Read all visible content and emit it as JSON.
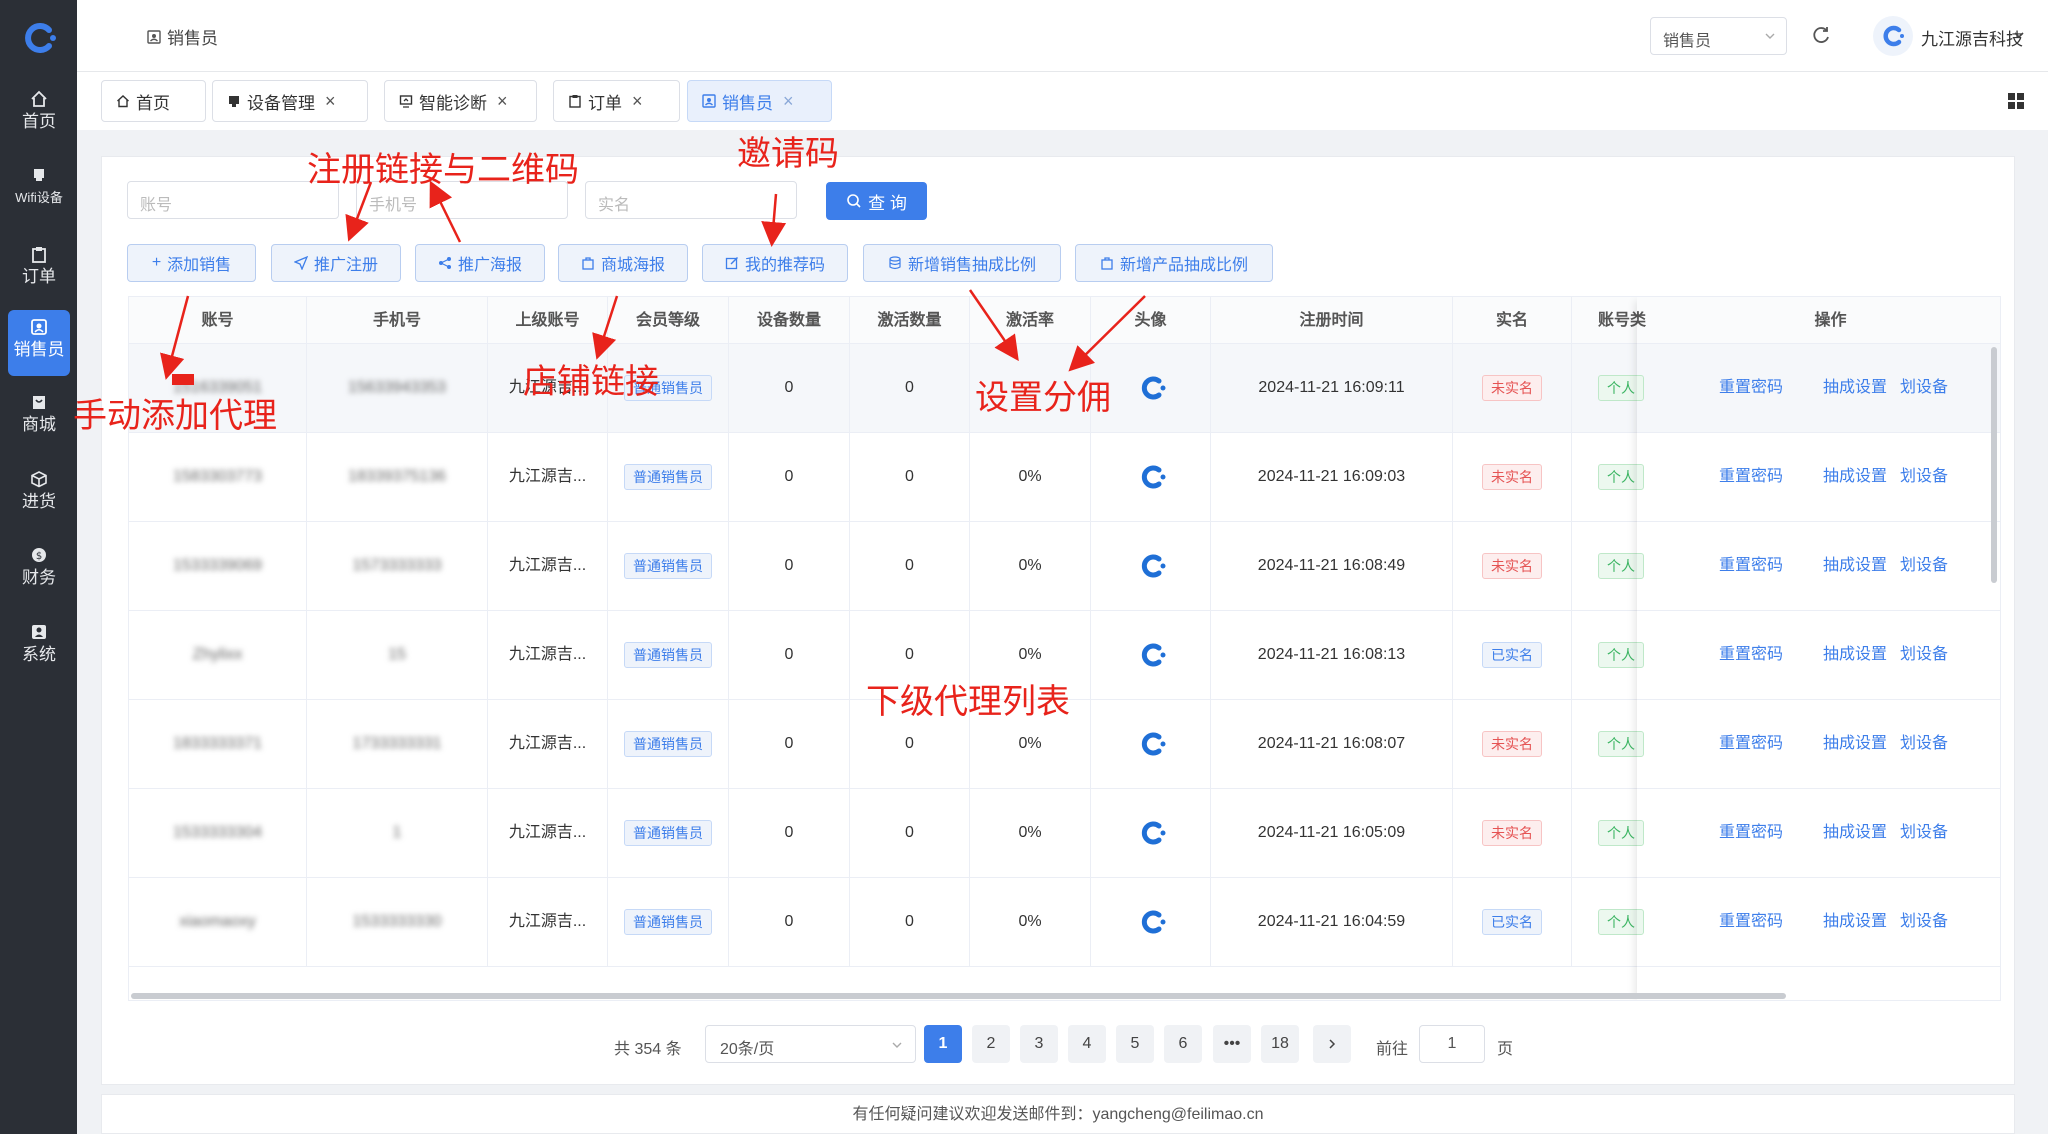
{
  "sidebar": {
    "items": [
      {
        "label": "首页",
        "icon": "home-icon"
      },
      {
        "label": "Wifi设备",
        "icon": "device-icon"
      },
      {
        "label": "订单",
        "icon": "clipboard-icon"
      },
      {
        "label": "销售员",
        "icon": "user-card-icon",
        "active": true
      },
      {
        "label": "商城",
        "icon": "shop-icon"
      },
      {
        "label": "进货",
        "icon": "box-icon"
      },
      {
        "label": "财务",
        "icon": "coin-icon"
      },
      {
        "label": "系统",
        "icon": "system-icon"
      }
    ]
  },
  "header": {
    "breadcrumb": "销售员",
    "role_select": "销售员",
    "user_name": "九江源吉科技"
  },
  "tabs": [
    {
      "label": "首页"
    },
    {
      "label": "设备管理"
    },
    {
      "label": "智能诊断"
    },
    {
      "label": "订单"
    },
    {
      "label": "销售员",
      "active": true
    }
  ],
  "search": {
    "account_placeholder": "账号",
    "phone_placeholder": "手机号",
    "realname_placeholder": "实名",
    "query_label": "查 询"
  },
  "actions": {
    "add": "添加销售",
    "promote_register": "推广注册",
    "promote_poster": "推广海报",
    "mall_poster": "商城海报",
    "my_referral": "我的推荐码",
    "add_sales_ratio": "新增销售抽成比例",
    "add_product_ratio": "新增产品抽成比例"
  },
  "table": {
    "columns": [
      "账号",
      "手机号",
      "上级账号",
      "会员等级",
      "设备数量",
      "激活数量",
      "激活率",
      "头像",
      "注册时间",
      "实名",
      "账号类",
      "操作"
    ],
    "rows": [
      {
        "account": "1516339051",
        "phone": "15633943353",
        "parent": "九江源吉...",
        "level": "普通销售员",
        "devices": "0",
        "activated": "0",
        "rate": "",
        "time": "2024-11-21 16:09:11",
        "realname": "未实名",
        "realname_color": "red",
        "type": "个人"
      },
      {
        "account": "1583303773",
        "phone": "18339375136",
        "parent": "九江源吉...",
        "level": "普通销售员",
        "devices": "0",
        "activated": "0",
        "rate": "0%",
        "time": "2024-11-21 16:09:03",
        "realname": "未实名",
        "realname_color": "red",
        "type": "个人"
      },
      {
        "account": "1533339069",
        "phone": "1573333333",
        "parent": "九江源吉...",
        "level": "普通销售员",
        "devices": "0",
        "activated": "0",
        "rate": "0%",
        "time": "2024-11-21 16:08:49",
        "realname": "未实名",
        "realname_color": "red",
        "type": "个人"
      },
      {
        "account": "Zhylixx",
        "phone": "15",
        "parent": "九江源吉...",
        "level": "普通销售员",
        "devices": "0",
        "activated": "0",
        "rate": "0%",
        "time": "2024-11-21 16:08:13",
        "realname": "已实名",
        "realname_color": "blue",
        "type": "个人"
      },
      {
        "account": "1833333371",
        "phone": "1733333331",
        "parent": "九江源吉...",
        "level": "普通销售员",
        "devices": "0",
        "activated": "0",
        "rate": "0%",
        "time": "2024-11-21 16:08:07",
        "realname": "未实名",
        "realname_color": "red",
        "type": "个人"
      },
      {
        "account": "1533333304",
        "phone": "1",
        "parent": "九江源吉...",
        "level": "普通销售员",
        "devices": "0",
        "activated": "0",
        "rate": "0%",
        "time": "2024-11-21 16:05:09",
        "realname": "未实名",
        "realname_color": "red",
        "type": "个人"
      },
      {
        "account": "xiaomaoxy",
        "phone": "1533333330",
        "parent": "九江源吉...",
        "level": "普通销售员",
        "devices": "0",
        "activated": "0",
        "rate": "0%",
        "time": "2024-11-21 16:04:59",
        "realname": "已实名",
        "realname_color": "blue",
        "type": "个人"
      }
    ],
    "ops": [
      "重置密码",
      "抽成设置",
      "划设备"
    ]
  },
  "pagination": {
    "total": "共 354 条",
    "page_size": "20条/页",
    "pages": [
      "1",
      "2",
      "3",
      "4",
      "5",
      "6",
      "•••",
      "18"
    ],
    "current": "1",
    "goto_label": "前往",
    "goto_value": "1",
    "goto_unit": "页"
  },
  "footer": {
    "text": "有任何疑问建议欢迎发送邮件到：yangcheng@feilimao.cn"
  },
  "annotations": {
    "register_link": "注册链接与二维码",
    "invite_code": "邀请码",
    "add_agent": "手动添加代理",
    "store_link": "店铺链接",
    "commission": "设置分佣",
    "sub_list": "下级代理列表"
  },
  "colors": {
    "accent": "#3d7eea",
    "sidebar": "#2b2f36",
    "annotation": "#e8231b"
  }
}
